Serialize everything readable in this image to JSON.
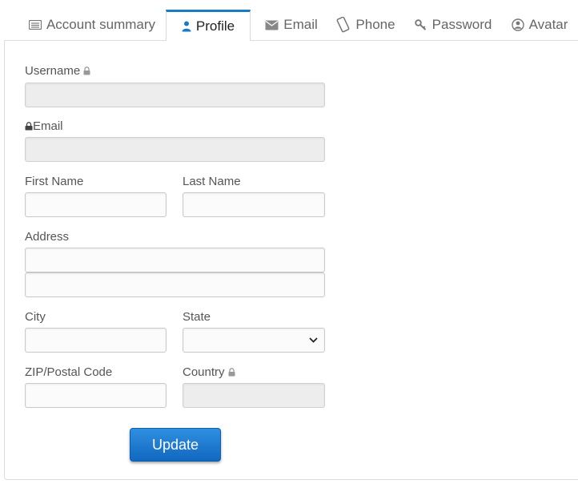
{
  "tabs": [
    {
      "label": "Account summary",
      "icon": "account-summary-icon",
      "active": false
    },
    {
      "label": "Profile",
      "icon": "user-icon",
      "active": true
    },
    {
      "label": "Email",
      "icon": "envelope-icon",
      "active": false
    },
    {
      "label": "Phone",
      "icon": "phone-icon",
      "active": false
    },
    {
      "label": "Password",
      "icon": "key-icon",
      "active": false
    },
    {
      "label": "Avatar",
      "icon": "avatar-icon",
      "active": false
    }
  ],
  "form": {
    "username_label": "Username",
    "email_label": "Email",
    "first_name_label": "First Name",
    "last_name_label": "Last Name",
    "address_label": "Address",
    "city_label": "City",
    "state_label": "State",
    "zip_label": "ZIP/Postal Code",
    "country_label": "Country",
    "username_value": "",
    "email_value": "",
    "first_name_value": "",
    "last_name_value": "",
    "address1_value": "",
    "address2_value": "",
    "city_value": "",
    "state_value": "",
    "zip_value": "",
    "country_value": "",
    "update_label": "Update"
  },
  "colors": {
    "accent": "#1a7ac4",
    "button": "#1168c0",
    "disabled_field": "#ededed"
  }
}
